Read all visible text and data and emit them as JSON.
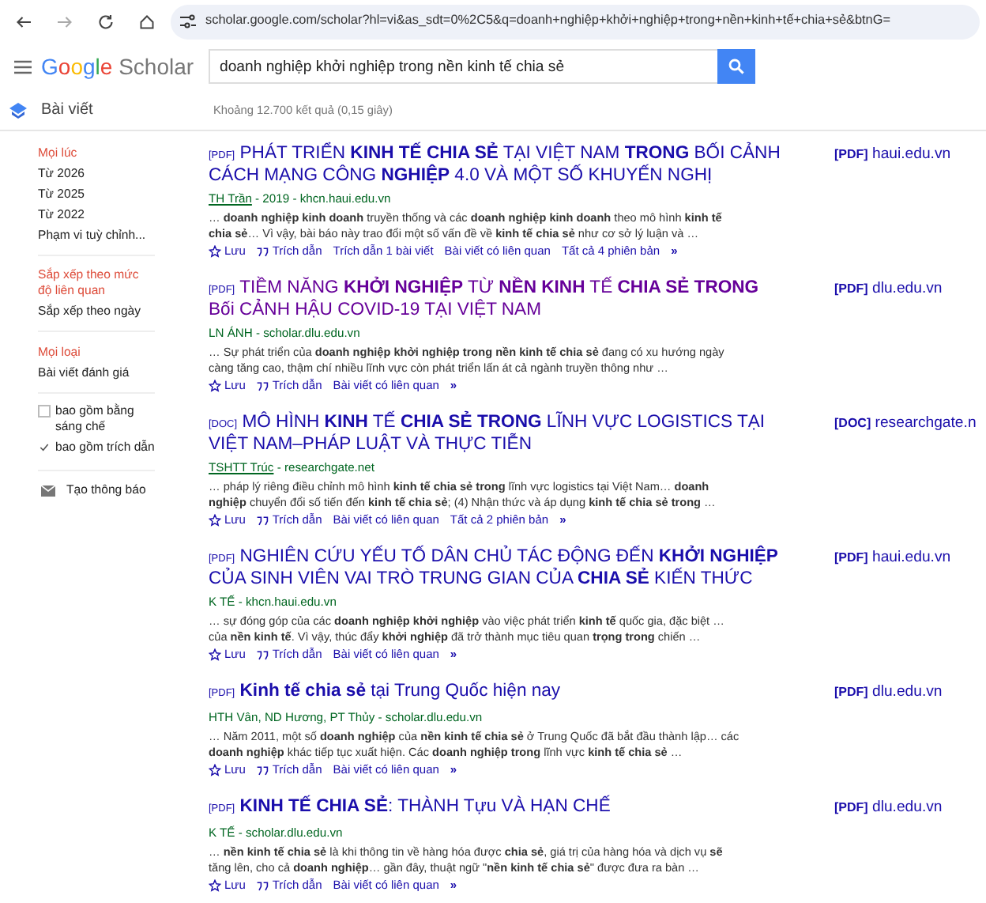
{
  "browser": {
    "url": "scholar.google.com/scholar?hl=vi&as_sdt=0%2C5&q=doanh+nghiệp+khởi+nghiệp+trong+nền+kinh+tế+chia+sẻ&btnG="
  },
  "header": {
    "logo_brand": "Google",
    "logo_product": "Scholar",
    "search_value": "doanh nghiệp khởi nghiệp trong nền kinh tế chia sẻ"
  },
  "subheader": {
    "section": "Bài viết",
    "stats": "Khoảng 12.700 kết quả (0,15 giây)"
  },
  "sidebar": {
    "groups": [
      {
        "items": [
          {
            "label": "Mọi lúc",
            "selected": true
          },
          {
            "label": "Từ 2026",
            "selected": false
          },
          {
            "label": "Từ 2025",
            "selected": false
          },
          {
            "label": "Từ 2022",
            "selected": false
          },
          {
            "label": "Phạm vi tuỳ chỉnh...",
            "selected": false
          }
        ]
      },
      {
        "items": [
          {
            "label": "Sắp xếp theo mức độ liên quan",
            "selected": true
          },
          {
            "label": "Sắp xếp theo ngày",
            "selected": false
          }
        ]
      },
      {
        "items": [
          {
            "label": "Mọi loại",
            "selected": true
          },
          {
            "label": "Bài viết đánh giá",
            "selected": false
          }
        ]
      }
    ],
    "checkboxes": [
      {
        "label": "bao gồm bằng sáng chế",
        "checked": false
      },
      {
        "label": "bao gồm trích dẫn",
        "checked": true
      }
    ],
    "alert": "Tạo thông báo"
  },
  "results": [
    {
      "type": "[PDF]",
      "title": "PHÁT TRIỂN **KINH TẾ CHIA SẺ** TẠI VIỆT NAM **TRONG** BỐI CẢNH CÁCH MẠNG CÔNG **NGHIỆP** 4.0 VÀ MỘT SỐ KHUYẾN NGHỊ",
      "visited": false,
      "authors": "TH Trần",
      "authors_linked": true,
      "source": " - 2019 - khcn.haui.edu.vn",
      "snippet": "… **doanh nghiệp kinh doanh** truyền thống và các **doanh nghiệp kinh doanh** theo mô hình **kinh tế chia sẻ**… Vì vậy, bài báo này trao đổi một số vấn đề về **kinh tế chia sẻ** như cơ sở lý luận và …",
      "actions": [
        {
          "kind": "save",
          "label": "Lưu"
        },
        {
          "kind": "cite",
          "label": "Trích dẫn"
        },
        {
          "kind": "link",
          "label": "Trích dẫn 1 bài viết"
        },
        {
          "kind": "link",
          "label": "Bài viết có liên quan"
        },
        {
          "kind": "link",
          "label": "Tất cả 4 phiên bản"
        },
        {
          "kind": "more",
          "label": "»"
        }
      ],
      "file_type": "[PDF]",
      "file_host": "haui.edu.vn"
    },
    {
      "type": "[PDF]",
      "title": "TIỀM NĂNG **KHỞI NGHIỆP** TỪ **NỀN KINH** TẾ **CHIA SẺ TRONG** Bối CẢNH HẬU COVID-19 TẠI VIỆT NAM",
      "visited": true,
      "authors": "LN ÁNH",
      "authors_linked": false,
      "source": " - scholar.dlu.edu.vn",
      "snippet": "… Sự phát triển của **doanh nghiệp khởi nghiệp trong nền kinh tế chia sẻ** đang có xu hướng ngày càng tăng cao, thậm chí nhiều lĩnh vực còn phát triển lấn át cả ngành truyền thông như …",
      "actions": [
        {
          "kind": "save",
          "label": "Lưu"
        },
        {
          "kind": "cite",
          "label": "Trích dẫn"
        },
        {
          "kind": "link",
          "label": "Bài viết có liên quan"
        },
        {
          "kind": "more",
          "label": "»"
        }
      ],
      "file_type": "[PDF]",
      "file_host": "dlu.edu.vn"
    },
    {
      "type": "[DOC]",
      "title": "MÔ HÌNH **KINH** TẾ **CHIA SẺ TRONG** LĨNH VỰC LOGISTICS TẠI VIỆT NAM–PHÁP LUẬT VÀ THỰC TIỄN",
      "visited": false,
      "authors": "TSHTT Trúc",
      "authors_linked": true,
      "source": " - researchgate.net",
      "snippet": "… pháp lý riêng điều chỉnh mô hình **kinh tế chia sẻ trong** lĩnh vực logistics tại Việt Nam… **doanh nghiệp** chuyển đổi số tiến đến **kinh tế chia sẻ**; (4) Nhận thức và áp dụng **kinh tế chia sẻ trong** …",
      "actions": [
        {
          "kind": "save",
          "label": "Lưu"
        },
        {
          "kind": "cite",
          "label": "Trích dẫn"
        },
        {
          "kind": "link",
          "label": "Bài viết có liên quan"
        },
        {
          "kind": "link",
          "label": "Tất cả 2 phiên bản"
        },
        {
          "kind": "more",
          "label": "»"
        }
      ],
      "file_type": "[DOC]",
      "file_host": "researchgate.n"
    },
    {
      "type": "[PDF]",
      "title": "NGHIÊN CỨU YẾU TỐ DÂN CHỦ TÁC ĐỘNG ĐẾN **KHỞI NGHIỆP** CỦA SINH VIÊN VAI TRÒ TRUNG GIAN CỦA **CHIA SẺ** KIẾN THỨC",
      "visited": false,
      "authors": "K TẾ",
      "authors_linked": false,
      "source": " - khcn.haui.edu.vn",
      "snippet": "… sự đóng góp của các **doanh nghiệp khởi nghiệp** vào việc phát triển **kinh tế** quốc gia, đặc biệt … của **nền kinh tế**. Vì vậy, thúc đẩy **khởi nghiệp** đã trở thành mục tiêu quan **trọng trong** chiến …",
      "actions": [
        {
          "kind": "save",
          "label": "Lưu"
        },
        {
          "kind": "cite",
          "label": "Trích dẫn"
        },
        {
          "kind": "link",
          "label": "Bài viết có liên quan"
        },
        {
          "kind": "more",
          "label": "»"
        }
      ],
      "file_type": "[PDF]",
      "file_host": "haui.edu.vn"
    },
    {
      "type": "[PDF]",
      "title": "**Kinh tế chia sẻ** tại Trung Quốc hiện nay",
      "visited": false,
      "authors": "HTH Vân, ND Hương, PT Thủy",
      "authors_linked": false,
      "source": " - scholar.dlu.edu.vn",
      "snippet": "… Năm 2011, một số **doanh nghiệp** của **nền kinh tế chia sẻ** ở Trung Quốc đã bắt đầu thành lập… các **doanh nghiệp** khác tiếp tục xuất hiện. Các **doanh nghiệp trong** lĩnh vực **kinh tế chia sẻ** …",
      "actions": [
        {
          "kind": "save",
          "label": "Lưu"
        },
        {
          "kind": "cite",
          "label": "Trích dẫn"
        },
        {
          "kind": "link",
          "label": "Bài viết có liên quan"
        },
        {
          "kind": "more",
          "label": "»"
        }
      ],
      "file_type": "[PDF]",
      "file_host": "dlu.edu.vn"
    },
    {
      "type": "[PDF]",
      "title": "**KINH TẾ CHIA SẺ**: THÀNH Tựu VÀ HẠN CHẾ",
      "visited": false,
      "authors": "K TẾ",
      "authors_linked": false,
      "source": " - scholar.dlu.edu.vn",
      "snippet": "… **nền kinh tế chia sẻ** là khi thông tin về hàng hóa được **chia sẻ**, giá trị của hàng hóa và dịch vụ **sẽ** tăng lên, cho cả **doanh nghiệp**… gần đây, thuật ngữ \"**nền kinh tế chia sẻ**\" được đưa ra bàn …",
      "actions": [
        {
          "kind": "save",
          "label": "Lưu"
        },
        {
          "kind": "cite",
          "label": "Trích dẫn"
        },
        {
          "kind": "link",
          "label": "Bài viết có liên quan"
        },
        {
          "kind": "more",
          "label": "»"
        }
      ],
      "file_type": "[PDF]",
      "file_host": "dlu.edu.vn"
    }
  ]
}
